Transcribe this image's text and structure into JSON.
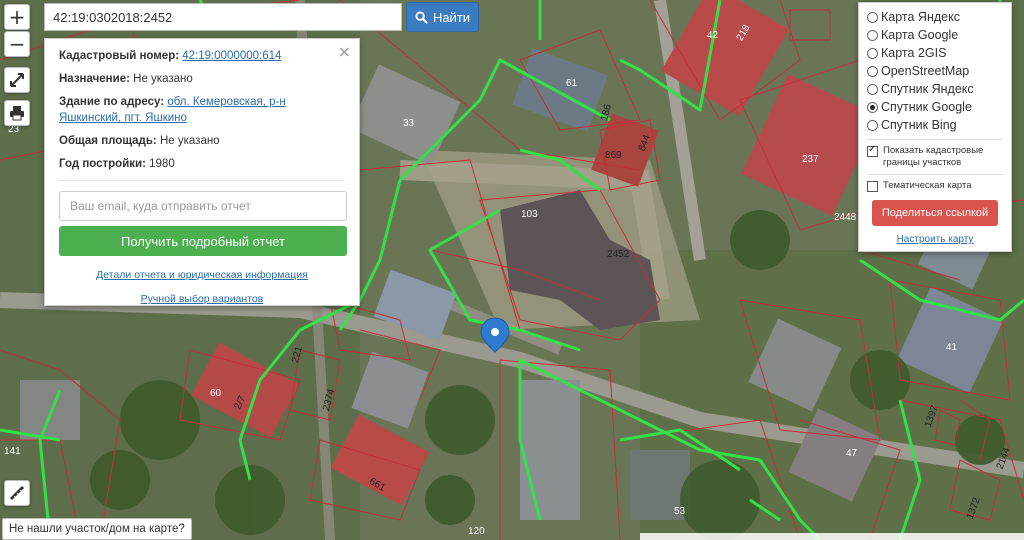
{
  "search": {
    "value": "42:19:0302018:2452",
    "button_label": "Найти"
  },
  "map_controls": {
    "zoom_in": "+",
    "zoom_out": "−"
  },
  "info": {
    "cadastral_label": "Кадастровый номер:",
    "cadastral_value": "42:19:0000000:614",
    "purpose_label": "Назначение:",
    "purpose_value": "Не указано",
    "address_label": "Здание по адресу:",
    "address_value": "обл. Кемеровская, р-н Яшкинский, пгт. Яшкино",
    "area_label": "Общая площадь:",
    "area_value": "Не указано",
    "year_label": "Год постройки:",
    "year_value": "1980",
    "email_placeholder": "Ваш email, куда отправить отчет",
    "report_button": "Получить подробный отчет",
    "details_link": "Детали отчета и юридическая информация",
    "manual_link": "Ручной выбор вариантов",
    "close": "×"
  },
  "layers": {
    "options": [
      {
        "label": "Карта Яндекс",
        "selected": false
      },
      {
        "label": "Карта Google",
        "selected": false
      },
      {
        "label": "Карта 2GIS",
        "selected": false
      },
      {
        "label": "OpenStreetMap",
        "selected": false
      },
      {
        "label": "Спутник Яндекс",
        "selected": false
      },
      {
        "label": "Спутник Google",
        "selected": true
      },
      {
        "label": "Спутник Bing",
        "selected": false
      }
    ],
    "show_borders_label": "Показать кадастровые границы участков",
    "show_borders_checked": true,
    "thematic_label": "Тематическая карта",
    "thematic_checked": false,
    "share_button": "Поделиться ссылкой",
    "settings_link": "Настроить карту"
  },
  "not_found": "Не нашли участок/дом на карте?",
  "map_labels": [
    {
      "id": "l61",
      "text": "61"
    },
    {
      "id": "l42",
      "text": "42"
    },
    {
      "id": "l218",
      "text": "218"
    },
    {
      "id": "l33",
      "text": "33"
    },
    {
      "id": "l23",
      "text": "23"
    },
    {
      "id": "l186",
      "text": "186"
    },
    {
      "id": "l869",
      "text": "869"
    },
    {
      "id": "l844",
      "text": "844"
    },
    {
      "id": "l237",
      "text": "237"
    },
    {
      "id": "l2448",
      "text": "2448"
    },
    {
      "id": "l103",
      "text": "103"
    },
    {
      "id": "l2452",
      "text": "2452"
    },
    {
      "id": "l41",
      "text": "41"
    },
    {
      "id": "l60",
      "text": "60"
    },
    {
      "id": "l277",
      "text": "2/7"
    },
    {
      "id": "l221",
      "text": "221"
    },
    {
      "id": "l2374",
      "text": "2374"
    },
    {
      "id": "l661",
      "text": "661"
    },
    {
      "id": "l47",
      "text": "47"
    },
    {
      "id": "l53",
      "text": "53"
    },
    {
      "id": "l120",
      "text": "120"
    },
    {
      "id": "l141",
      "text": "141"
    },
    {
      "id": "l1372",
      "text": "1372"
    },
    {
      "id": "l2144",
      "text": "2144"
    },
    {
      "id": "l1397",
      "text": "1397"
    }
  ],
  "colors": {
    "boundary_green": "#33e04a",
    "cadastral_red": "#c0303a",
    "search_blue": "#3b7bbf",
    "report_green": "#4caf50",
    "share_red": "#d9534f",
    "marker_blue": "#2f7bd0"
  }
}
